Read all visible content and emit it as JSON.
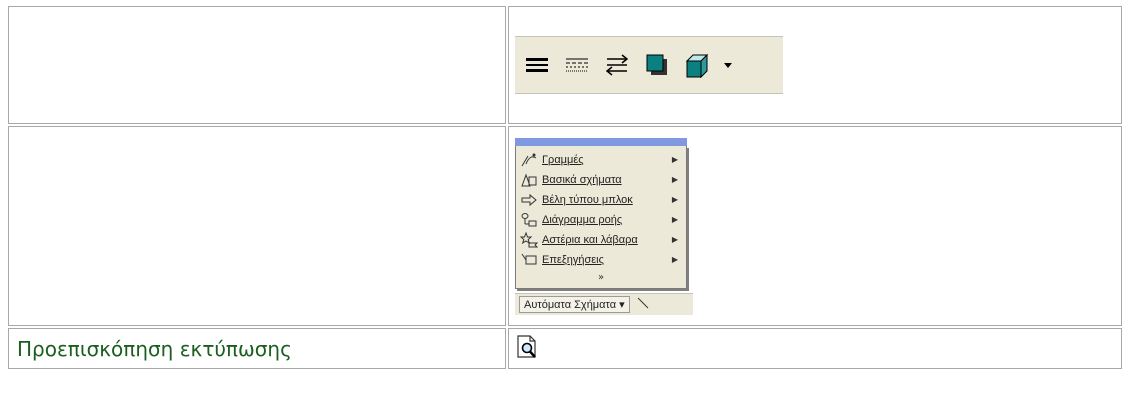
{
  "rows": [
    {
      "left_label": "",
      "right": {
        "toolbar_icons": [
          "line-style-icon",
          "dash-style-icon",
          "arrow-style-icon",
          "shadow-style-icon",
          "3d-style-icon",
          "dropdown-arrow-icon"
        ]
      }
    },
    {
      "left_label": "",
      "right": {
        "menu_items": [
          {
            "label": "Γραμμές",
            "icon": "lines-icon"
          },
          {
            "label": "Βασικά σχήματα",
            "icon": "basic-shapes-icon"
          },
          {
            "label": "Βέλη τύπου μπλοκ",
            "icon": "block-arrows-icon"
          },
          {
            "label": "Διάγραμμα ροής",
            "icon": "flowchart-icon"
          },
          {
            "label": "Αστέρια και λάβαρα",
            "icon": "stars-banners-icon"
          },
          {
            "label": "Επεξηγήσεις",
            "icon": "callouts-icon"
          }
        ],
        "more_glyph": "»",
        "autoshapes_button": "Αυτόματα Σχήματα ▾"
      }
    },
    {
      "left_label": "Προεπισκόπηση εκτύπωσης",
      "right": {
        "icon": "print-preview-icon"
      }
    }
  ],
  "colors": {
    "toolbar_bg": "#ece9d8",
    "label_green": "#1b5e20",
    "menu_titlebar": "#7f98e0",
    "teal": "#0a8080"
  }
}
